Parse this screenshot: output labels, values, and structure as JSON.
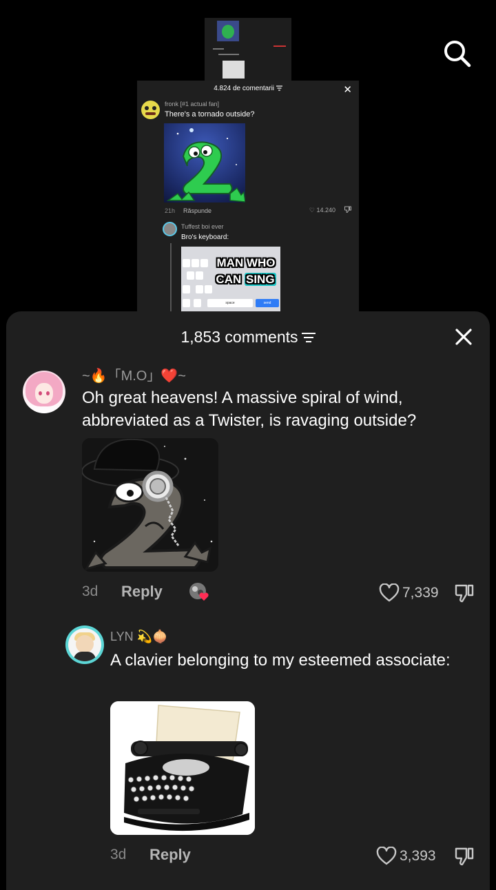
{
  "top": {
    "search_icon": "search-icon"
  },
  "embedded_top": {
    "tiny": {
      "image": "nested-comment-thumbnail"
    },
    "mid": {
      "header": "4.824 de comentarii",
      "comment": {
        "username": "fronk [#1 actual fan]",
        "text": "There's a tornado outside?",
        "time": "21h",
        "reply": "Răspunde",
        "likes": "14.240"
      },
      "reply_comment": {
        "username": "Tuffest boi ever",
        "text": "Bro's keyboard:",
        "caption_line1": "MAN WHO",
        "caption_line2a": "CAN",
        "caption_line2b": "SING",
        "kb_space": "space",
        "kb_send": "send"
      }
    }
  },
  "sheet": {
    "count": "1,853 comments",
    "comments": [
      {
        "username": "~🔥「M.O」❤️~",
        "text": "Oh great heavens! A massive spiral of wind, abbreviated as a Twister, is ravaging outside?",
        "time": "3d",
        "reply": "Reply",
        "likes": "7,339"
      },
      {
        "username": "LYN 💫🧅",
        "text": "A clavier belonging to my esteemed associate:",
        "time": "3d",
        "reply": "Reply",
        "likes": "3,393"
      }
    ]
  },
  "colors": {
    "sheet_bg": "#1f1f1f",
    "muted": "#8a8a8a",
    "accent_teal": "#5cd6d6"
  }
}
